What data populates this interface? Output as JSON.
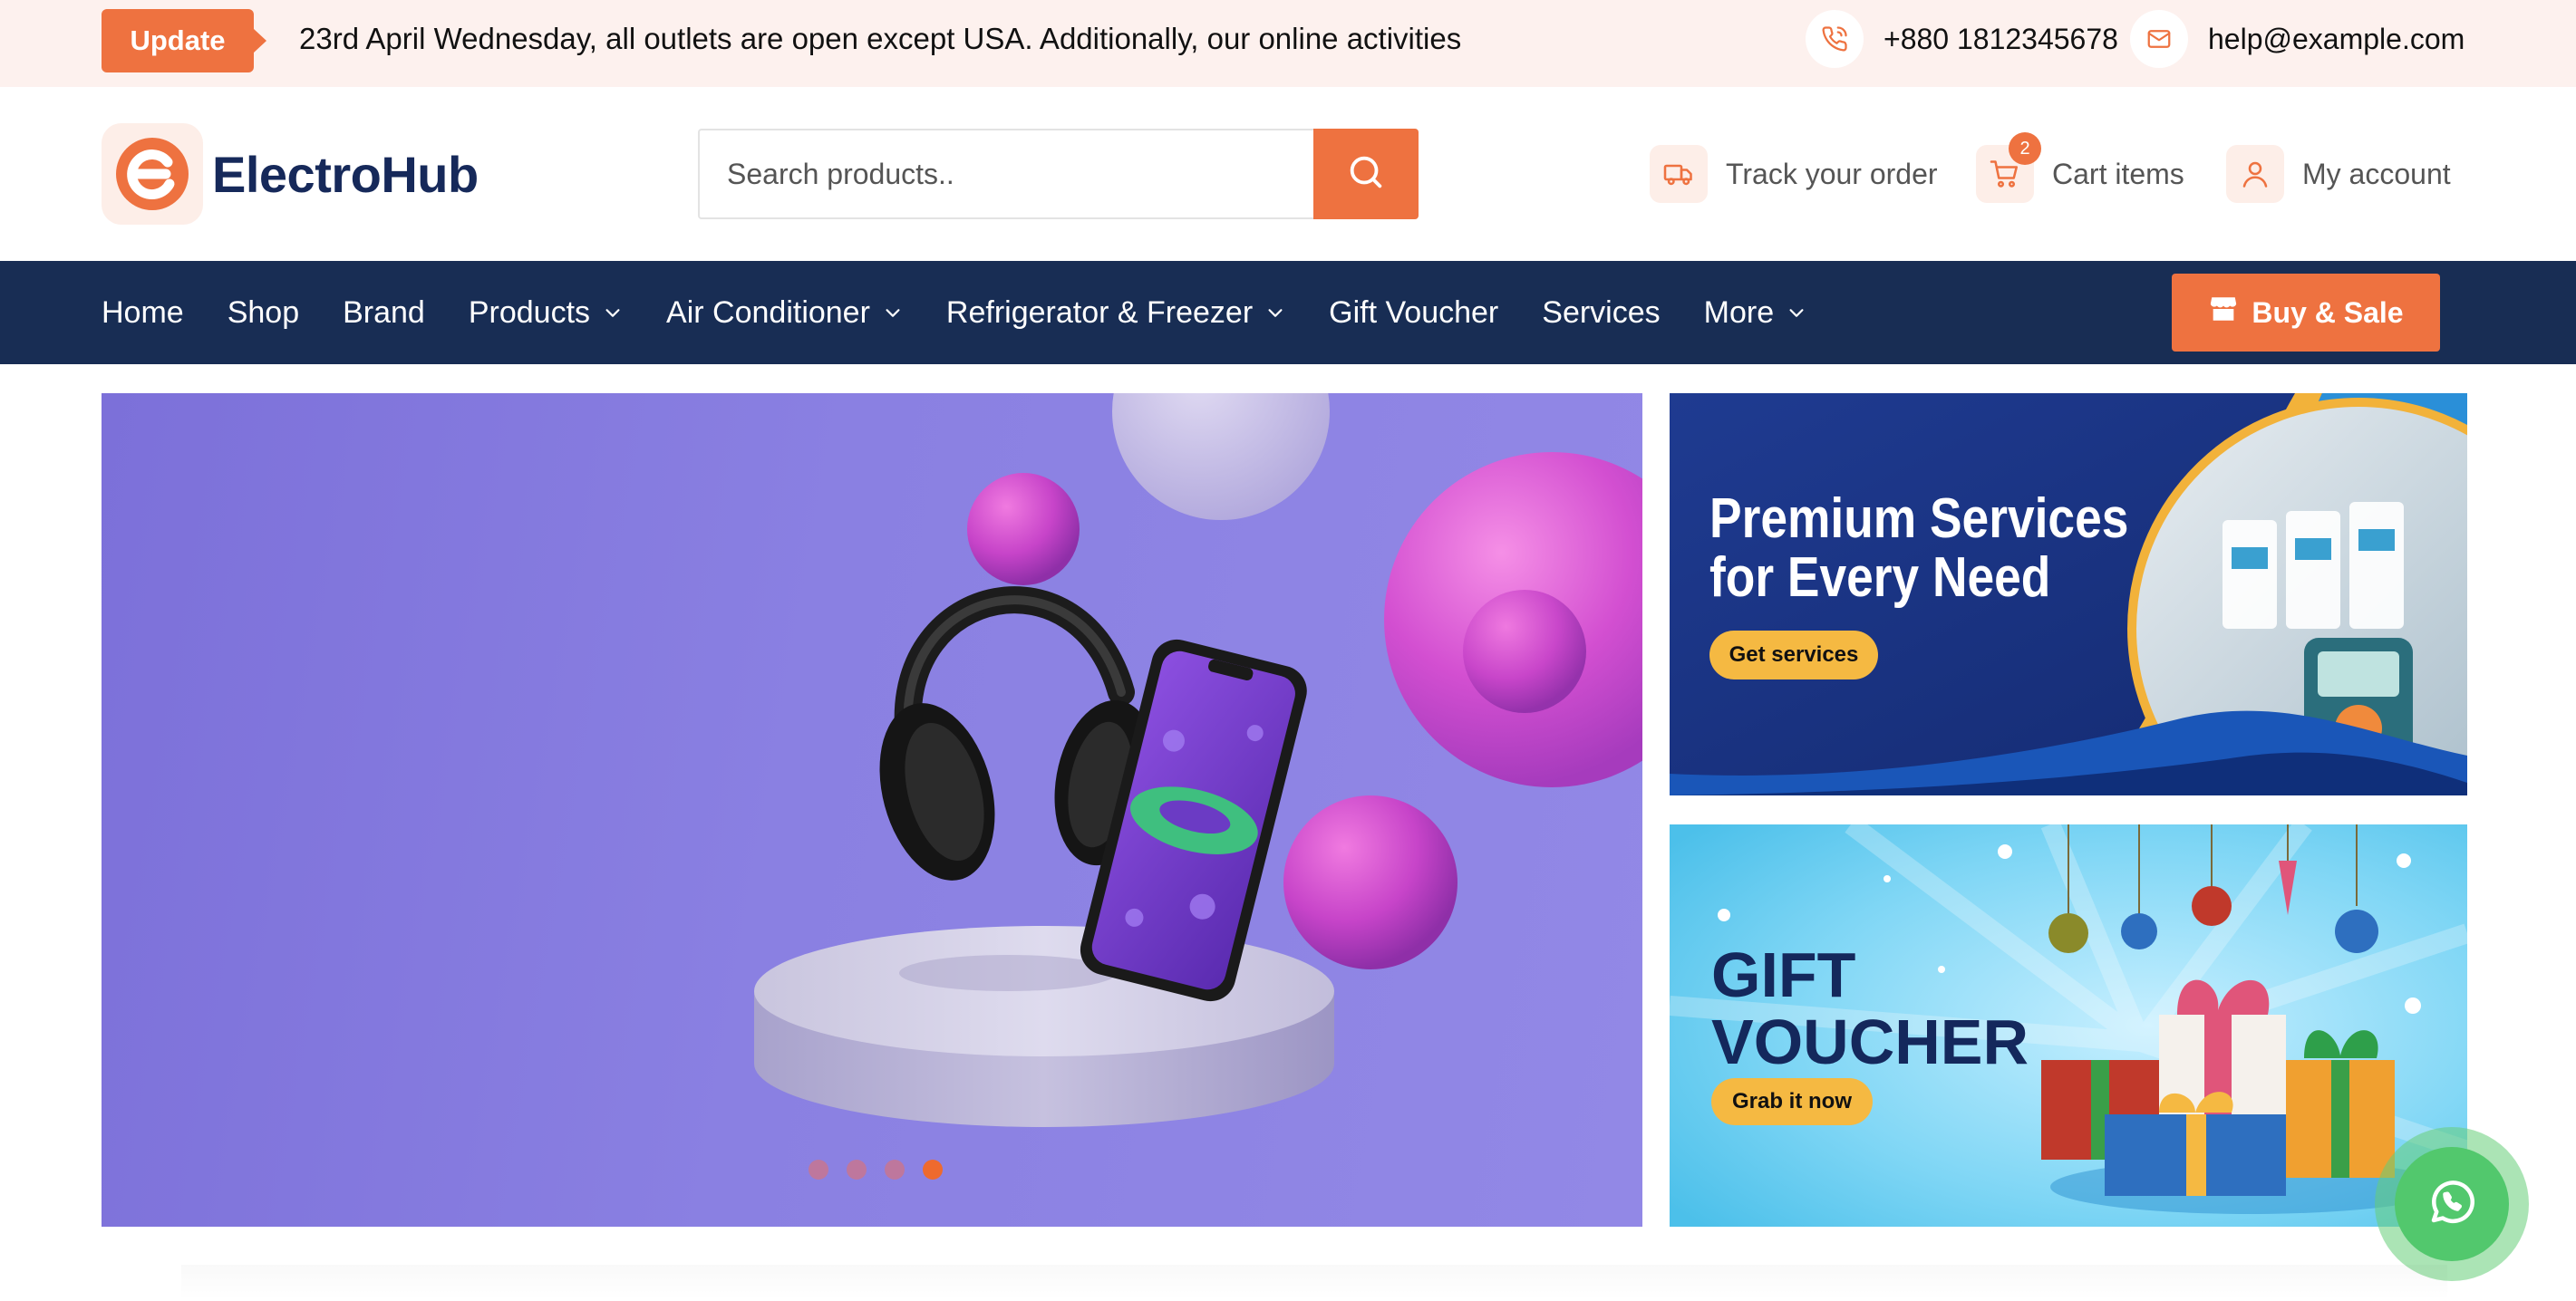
{
  "topbar": {
    "badge": "Update",
    "notice": "23rd April Wednesday, all outlets are open except USA. Additionally, our online activities",
    "phone": "+880 1812345678",
    "email": "help@example.com"
  },
  "header": {
    "logo_text": "ElectroHub",
    "search_placeholder": "Search products..",
    "track_label": "Track your order",
    "cart_label": "Cart items",
    "cart_count": "2",
    "account_label": "My account"
  },
  "nav": {
    "items": [
      {
        "label": "Home",
        "dropdown": false
      },
      {
        "label": "Shop",
        "dropdown": false
      },
      {
        "label": "Brand",
        "dropdown": false
      },
      {
        "label": "Products",
        "dropdown": true
      },
      {
        "label": "Air Conditioner",
        "dropdown": true
      },
      {
        "label": "Refrigerator & Freezer",
        "dropdown": true
      },
      {
        "label": "Gift Voucher",
        "dropdown": false
      },
      {
        "label": "Services",
        "dropdown": false
      },
      {
        "label": "More",
        "dropdown": true
      }
    ],
    "cta": "Buy & Sale"
  },
  "hero": {
    "slides_total": 4,
    "active_slide": 4
  },
  "banners": {
    "services": {
      "title_line1": "Premium Services",
      "title_line2": "for Every Need",
      "button": "Get services"
    },
    "gift": {
      "title_line1": "GIFT",
      "title_line2": "VOUCHER",
      "button": "Grab it now"
    }
  },
  "colors": {
    "accent": "#ee7240",
    "nav_bg": "#182d54",
    "topbar_bg": "#fdf1ee",
    "brand_text": "#16295a",
    "whatsapp": "#52c86d"
  },
  "icons": {
    "phone": "phone-icon",
    "email": "mail-icon",
    "search": "search-icon",
    "track": "truck-icon",
    "cart": "cart-icon",
    "account": "user-icon",
    "cta": "store-icon",
    "chat": "whatsapp-icon"
  }
}
